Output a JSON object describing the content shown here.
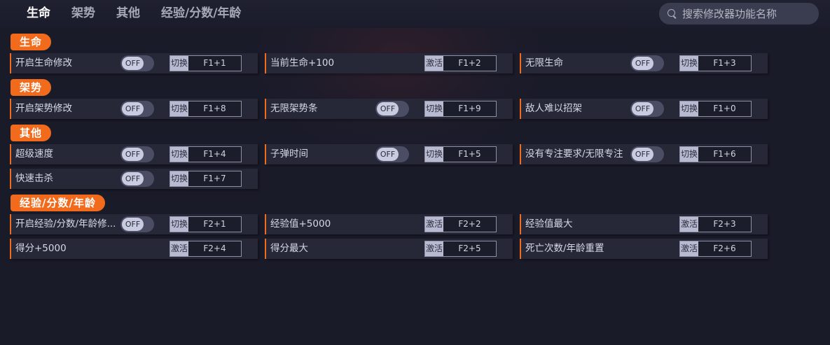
{
  "tabs": [
    "生命",
    "架势",
    "其他",
    "经验/分数/年龄"
  ],
  "search": {
    "placeholder": "搜索修改器功能名称"
  },
  "toggle_off_label": "OFF",
  "sections": [
    {
      "title": "生命"
    },
    {
      "title": "架势"
    },
    {
      "title": "其他"
    },
    {
      "title": "经验/分数/年龄"
    }
  ],
  "cheats": [
    {
      "name": "开启生命修改",
      "mode": "切换",
      "key": "F1+1"
    },
    {
      "name": "当前生命+100",
      "mode": "激活",
      "key": "F1+2"
    },
    {
      "name": "无限生命",
      "mode": "切换",
      "key": "F1+3"
    },
    {
      "name": "开启架势修改",
      "mode": "切换",
      "key": "F1+8"
    },
    {
      "name": "无限架势条",
      "mode": "切换",
      "key": "F1+9"
    },
    {
      "name": "敌人难以招架",
      "mode": "切换",
      "key": "F1+0"
    },
    {
      "name": "超级速度",
      "mode": "切换",
      "key": "F1+4"
    },
    {
      "name": "子弹时间",
      "mode": "切换",
      "key": "F1+5"
    },
    {
      "name": "没有专注要求/无限专注",
      "mode": "切换",
      "key": "F1+6"
    },
    {
      "name": "快速击杀",
      "mode": "切换",
      "key": "F1+7"
    },
    {
      "name": "开启经验/分数/年龄修...",
      "mode": "切换",
      "key": "F2+1"
    },
    {
      "name": "经验值+5000",
      "mode": "激活",
      "key": "F2+2"
    },
    {
      "name": "经验值最大",
      "mode": "激活",
      "key": "F2+3"
    },
    {
      "name": "得分+5000",
      "mode": "激活",
      "key": "F2+4"
    },
    {
      "name": "得分最大",
      "mode": "激活",
      "key": "F2+5"
    },
    {
      "name": "死亡次数/年龄重置",
      "mode": "激活",
      "key": "F2+6"
    }
  ],
  "colors": {
    "accent": "#f26a1b",
    "background": "#1a1b29",
    "row": "#262838"
  }
}
